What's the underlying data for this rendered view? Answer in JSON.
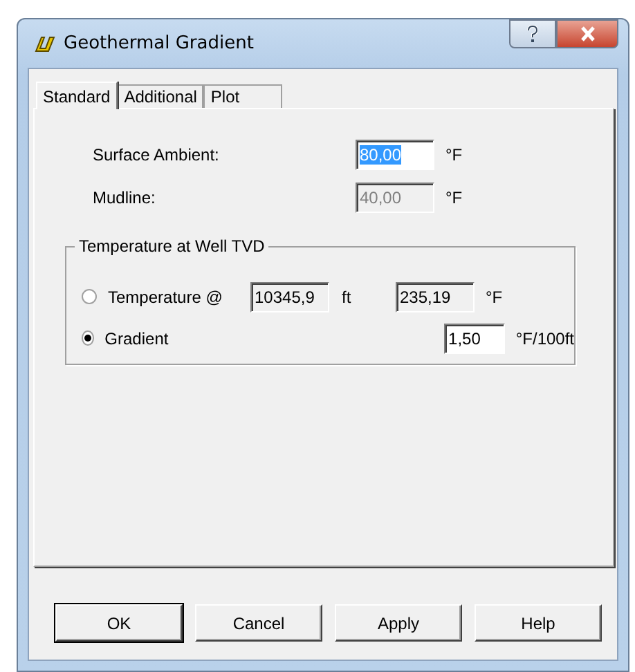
{
  "window": {
    "title": "Geothermal Gradient"
  },
  "tabs": [
    {
      "label": "Standard",
      "selected": true
    },
    {
      "label": "Additional",
      "selected": false
    },
    {
      "label": "Plot",
      "selected": false
    }
  ],
  "fields": [
    {
      "label": "Surface Ambient:",
      "value": "80,00",
      "unit": "°F",
      "disabled": false,
      "focused": true
    },
    {
      "label": "Mudline:",
      "value": "40,00",
      "unit": "°F",
      "disabled": true,
      "focused": false
    }
  ],
  "group": {
    "title": "Temperature at Well TVD",
    "options": [
      {
        "label": "Temperature @",
        "selected": false,
        "depth": {
          "value": "10345,9",
          "unit": "ft"
        },
        "value": "235,19",
        "unit": "°F"
      },
      {
        "label": "Gradient",
        "selected": true,
        "value": "1,50",
        "unit": "°F/100ft"
      }
    ]
  },
  "buttons": [
    "OK",
    "Cancel",
    "Apply",
    "Help"
  ]
}
